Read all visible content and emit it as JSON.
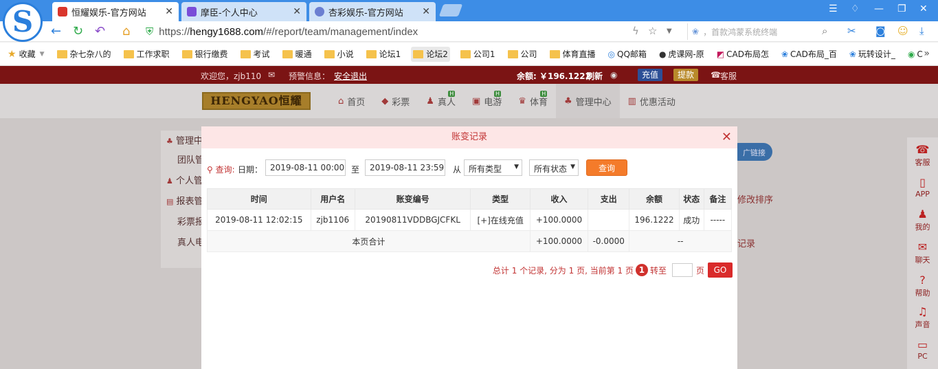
{
  "browser": {
    "logo_letter": "S",
    "tabs": [
      {
        "title": "恒耀娱乐-官方网站",
        "close": "✕",
        "fav_color": "#d9362c"
      },
      {
        "title": "摩臣-个人中心",
        "close": "✕",
        "fav_color": "#7a4ed8"
      },
      {
        "title": "杏彩娱乐-官方网站",
        "close": "✕",
        "fav_color": "#6b7fd1"
      }
    ],
    "url_scheme": "https://",
    "url_host": "hengy1688.com",
    "url_path": "/#/report/team/management/index",
    "search_placeholder": "，首款鸿蒙系统终端",
    "bookmarks": [
      "收藏",
      "杂七杂八的",
      "工作求职",
      "银行缴费",
      "考试",
      "暖通",
      "小说",
      "论坛1",
      "论坛2",
      "公司1",
      "公司",
      "体育直播",
      "QQ邮箱",
      "虎课网-原",
      "CAD布局怎",
      "CAD布局_百",
      "玩转设计_",
      "C"
    ]
  },
  "site": {
    "welcome": "欢迎您，zjb110",
    "warning": "预警信息：",
    "logout": "安全退出",
    "balance_label": "余额: ￥196.1222",
    "refresh": "刷新",
    "recharge": "充值",
    "withdraw": "提款",
    "service": "客服",
    "brand": "HENGYAO恒耀",
    "nav": [
      {
        "label": "首页",
        "icon": "home-icon",
        "glyph": "⌂",
        "sup": ""
      },
      {
        "label": "彩票",
        "icon": "lottery-icon",
        "glyph": "◆",
        "sup": ""
      },
      {
        "label": "真人",
        "icon": "live-icon",
        "glyph": "♟",
        "sup": "H"
      },
      {
        "label": "电游",
        "icon": "slot-icon",
        "glyph": "▣",
        "sup": "H"
      },
      {
        "label": "体育",
        "icon": "sports-icon",
        "glyph": "♛",
        "sup": "H"
      },
      {
        "label": "管理中心",
        "icon": "manage-icon",
        "glyph": "♣",
        "sup": ""
      },
      {
        "label": "优惠活动",
        "icon": "gift-icon",
        "glyph": "▥",
        "sup": ""
      }
    ],
    "sidebar": [
      "管理中",
      "团队管",
      "个人管",
      "报表管",
      "彩票报",
      "真人电"
    ],
    "bg_right_btn": "广链接",
    "bg_right_sort": "修改排序",
    "bg_right_record": "记录",
    "rightbar": [
      {
        "label": "客服",
        "icon": "headset-icon",
        "glyph": "☎"
      },
      {
        "label": "APP",
        "icon": "phone-icon",
        "glyph": "▯"
      },
      {
        "label": "我的",
        "icon": "user-icon",
        "glyph": "♟"
      },
      {
        "label": "聊天",
        "icon": "chat-icon",
        "glyph": "✉"
      },
      {
        "label": "帮助",
        "icon": "help-icon",
        "glyph": "?"
      },
      {
        "label": "声音",
        "icon": "sound-icon",
        "glyph": "♫"
      },
      {
        "label": "PC",
        "icon": "monitor-icon",
        "glyph": "▭"
      }
    ]
  },
  "modal": {
    "title": "账变记录",
    "close": "✕",
    "query_label": "查询:",
    "date_label": "日期：",
    "date_from": "2019-08-11 00:00",
    "to_label": "至",
    "date_to": "2019-08-11 23:59",
    "from_label": "从",
    "type_select": "所有类型",
    "status_select": "所有状态",
    "query_button": "查询",
    "columns": [
      "时间",
      "用户名",
      "账变编号",
      "类型",
      "收入",
      "支出",
      "余额",
      "状态",
      "备注"
    ],
    "rows": [
      {
        "time": "2019-08-11 12:02:15",
        "user": "zjb1106",
        "id": "20190811VDDBGJCFKL",
        "type": "[+]在线充值",
        "income": "+100.0000",
        "expense": "",
        "balance": "196.1222",
        "status": "成功",
        "note": "-----"
      }
    ],
    "summary": {
      "label": "本页合计",
      "income": "+100.0000",
      "expense": "-0.0000",
      "rest": "--"
    },
    "pager": {
      "text": "总计 1 个记录, 分为 1 页, 当前第 1 页",
      "current": "1",
      "goto_label": "转至",
      "page_unit": "页",
      "go": "GO"
    }
  }
}
